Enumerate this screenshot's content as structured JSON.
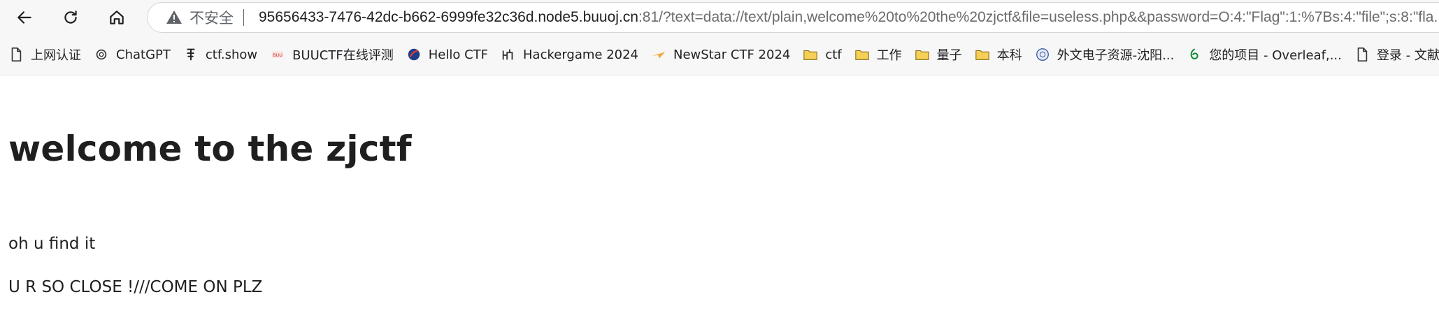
{
  "browser": {
    "security_label": "不安全",
    "url_host": "95656433-7476-42dc-b662-6999fe32c36d.node5.buuoj.cn",
    "url_rest": ":81/?text=data://text/plain,welcome%20to%20the%20zjctf&file=useless.php&&password=O:4:\"Flag\":1:%7Bs:4:\"file\";s:8:\"fla..."
  },
  "bookmarks": [
    {
      "label": "上网认证",
      "icon": "page-icon"
    },
    {
      "label": "ChatGPT",
      "icon": "chatgpt-icon"
    },
    {
      "label": "ctf.show",
      "icon": "ctfshow-icon"
    },
    {
      "label": "BUUCTF在线评测",
      "icon": "buuctf-icon"
    },
    {
      "label": "Hello CTF",
      "icon": "hellctf-icon"
    },
    {
      "label": "Hackergame 2024",
      "icon": "hackergame-icon"
    },
    {
      "label": "NewStar CTF 2024",
      "icon": "newstar-icon"
    },
    {
      "label": "ctf",
      "icon": "folder-icon"
    },
    {
      "label": "工作",
      "icon": "folder-icon"
    },
    {
      "label": "量子",
      "icon": "folder-icon"
    },
    {
      "label": "本科",
      "icon": "folder-icon"
    },
    {
      "label": "外文电子资源-沈阳...",
      "icon": "university-icon"
    },
    {
      "label": "您的项目 - Overleaf,...",
      "icon": "overleaf-icon"
    },
    {
      "label": "登录 - 文献",
      "icon": "page-icon"
    }
  ],
  "content": {
    "heading": "welcome to the zjctf",
    "line1": "oh u find it",
    "line2": "U R SO CLOSE !///COME ON PLZ"
  }
}
